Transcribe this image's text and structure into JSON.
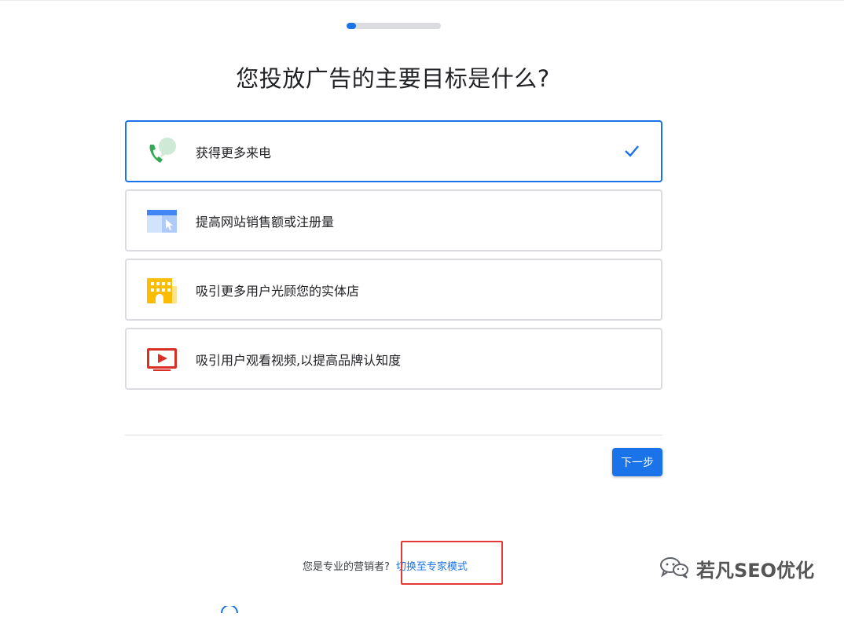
{
  "progress": {
    "fraction": 0.1
  },
  "title": "您投放广告的主要目标是什么?",
  "options": [
    {
      "label": "获得更多来电",
      "icon": "phone-call-icon",
      "selected": true
    },
    {
      "label": "提高网站销售额或注册量",
      "icon": "website-cursor-icon",
      "selected": false
    },
    {
      "label": "吸引更多用户光顾您的实体店",
      "icon": "storefront-icon",
      "selected": false
    },
    {
      "label": "吸引用户观看视频,以提高品牌认知度",
      "icon": "video-play-icon",
      "selected": false
    }
  ],
  "next_label": "下一步",
  "footer": {
    "prompt": "您是专业的营销者?",
    "link": "切换至专家模式"
  },
  "watermark": {
    "text": "若凡SEO优化",
    "icon": "wechat-icon"
  },
  "colors": {
    "accent": "#1a73e8",
    "border": "#dadce0",
    "highlight": "#e53935"
  }
}
